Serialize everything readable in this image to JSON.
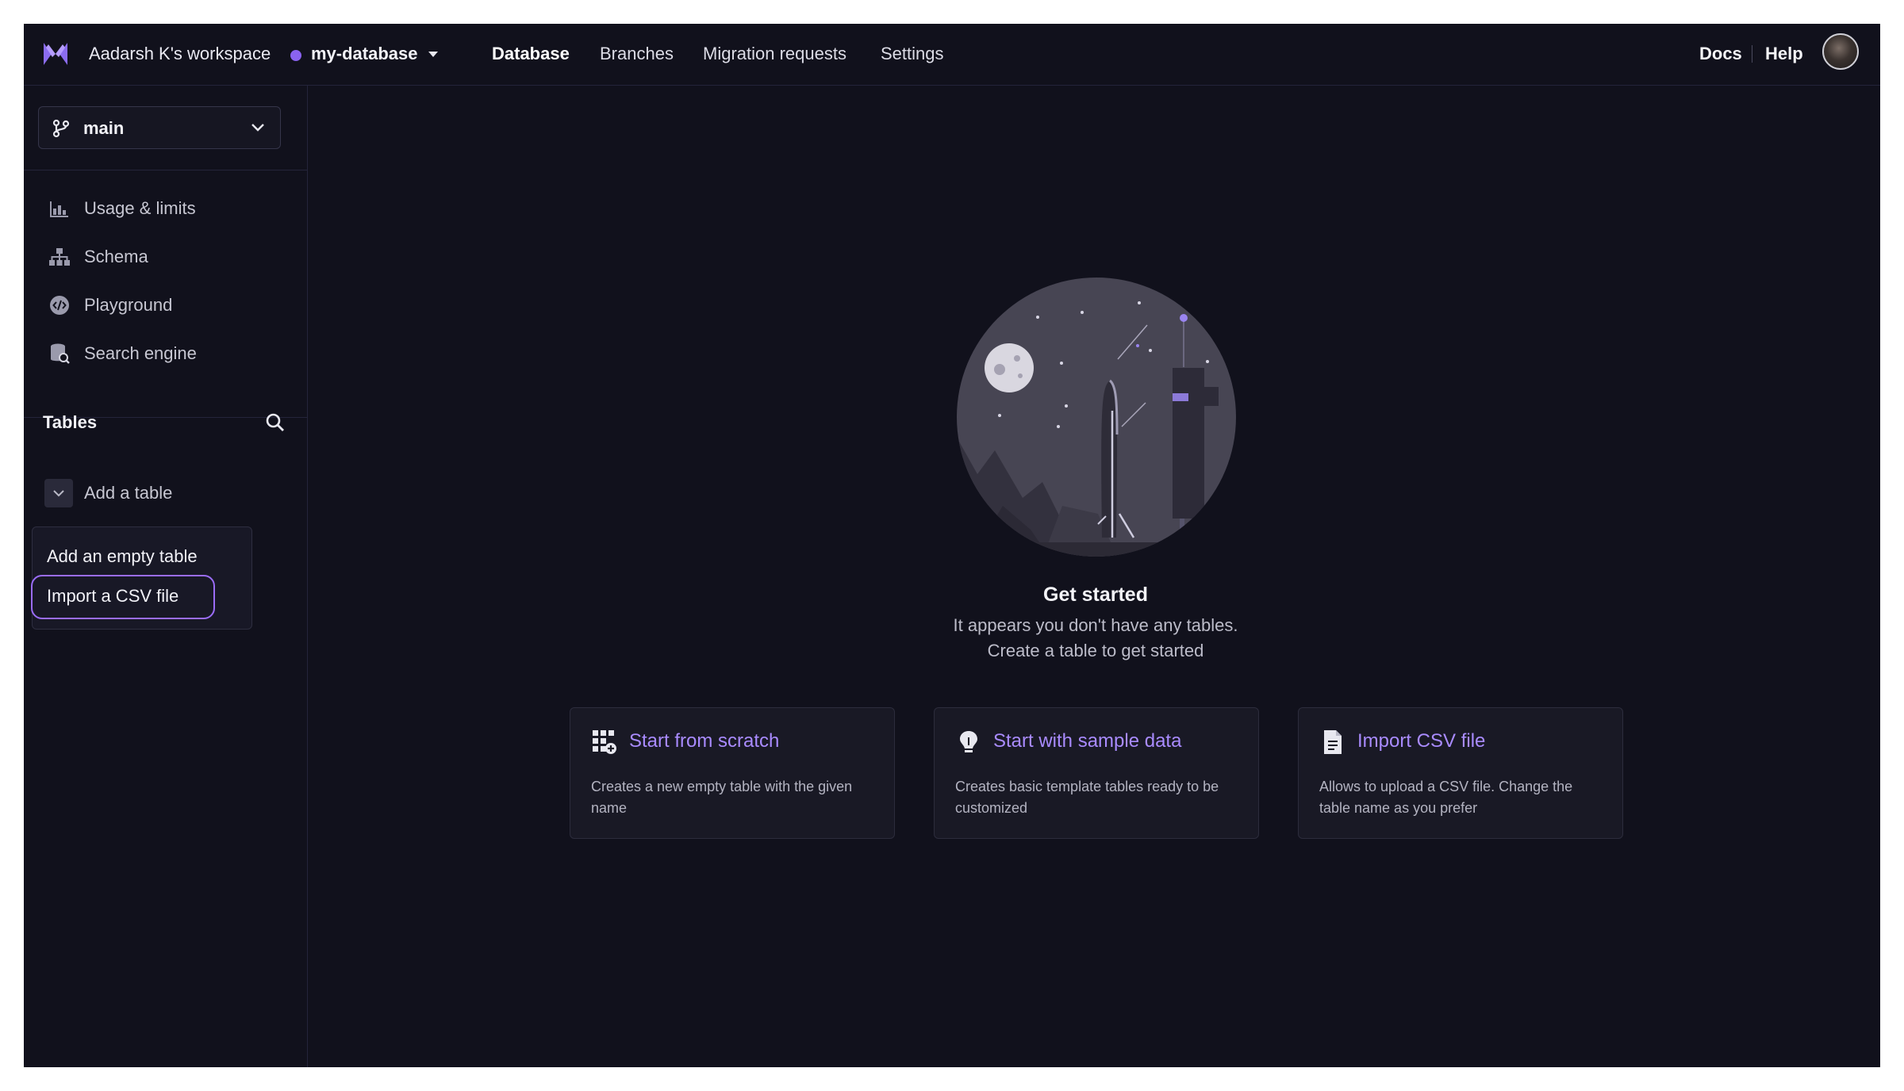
{
  "topbar": {
    "workspace": "Aadarsh K's workspace",
    "database": "my-database",
    "tabs": [
      "Database",
      "Branches",
      "Migration requests",
      "Settings"
    ],
    "active_tab": "Database",
    "docs": "Docs",
    "help": "Help"
  },
  "sidebar": {
    "branch": "main",
    "items": [
      {
        "label": "Usage & limits",
        "icon": "bar-chart-icon"
      },
      {
        "label": "Schema",
        "icon": "schema-tree-icon"
      },
      {
        "label": "Playground",
        "icon": "code-circle-icon"
      },
      {
        "label": "Search engine",
        "icon": "database-search-icon"
      }
    ],
    "tables_title": "Tables",
    "add_table": "Add a table",
    "dropdown": [
      "Add an empty table",
      "Import a CSV file"
    ]
  },
  "main": {
    "title": "Get started",
    "line1": "It appears you don't have any tables.",
    "line2": "Create a table to get started",
    "cards": [
      {
        "title": "Start from scratch",
        "desc": "Creates a new empty table with the given name",
        "icon": "table-add-icon"
      },
      {
        "title": "Start with sample data",
        "desc": "Creates basic template tables ready to be customized",
        "icon": "lightbulb-icon"
      },
      {
        "title": "Import CSV file",
        "desc": "Allows to upload a CSV file. Change the table name as you prefer",
        "icon": "file-icon"
      }
    ]
  },
  "colors": {
    "accent": "#a98bff",
    "background": "#11111c",
    "highlight": "#9a6cf6"
  }
}
